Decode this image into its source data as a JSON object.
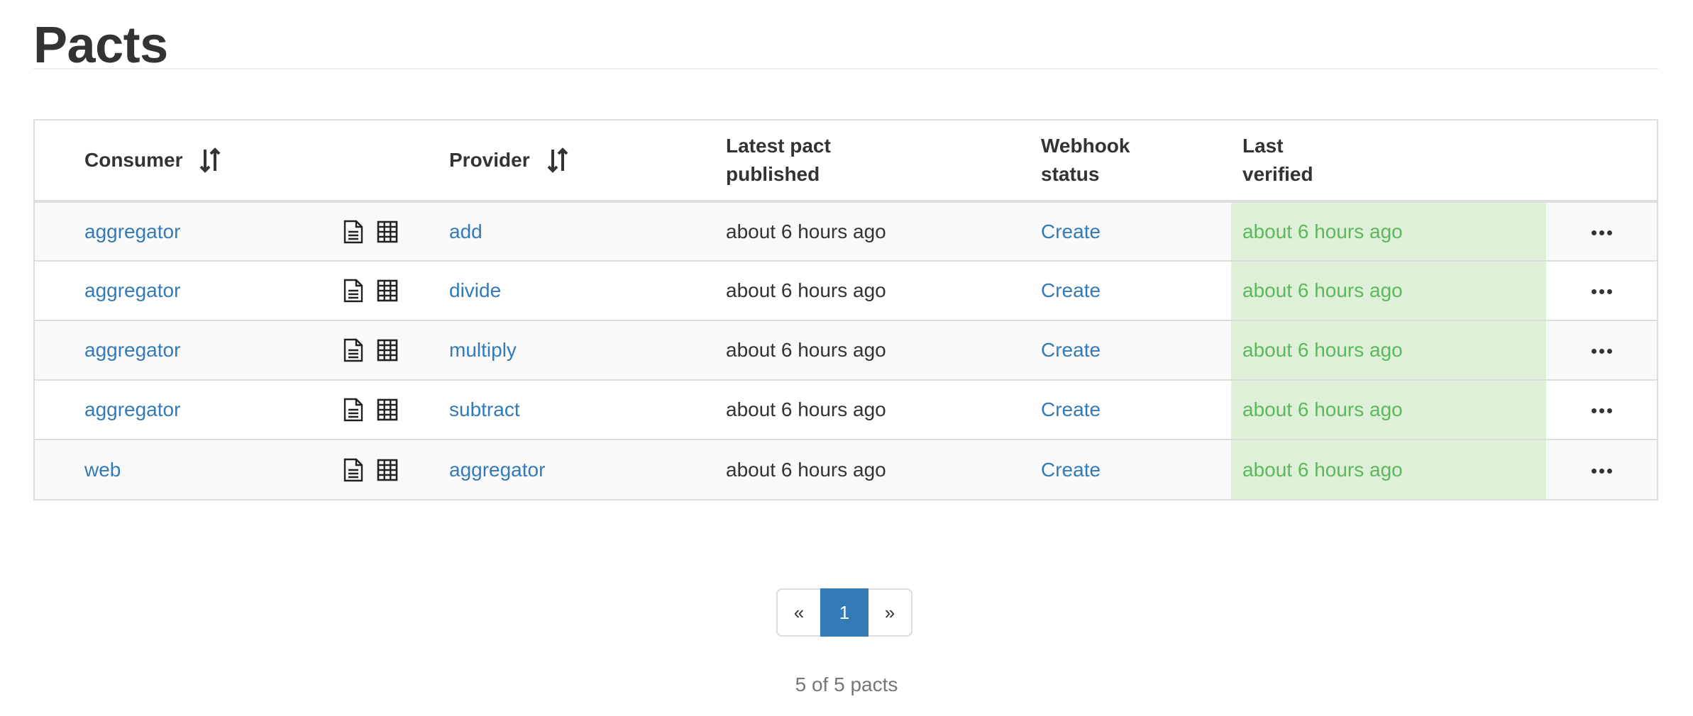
{
  "page": {
    "title": "Pacts"
  },
  "table": {
    "headers": {
      "consumer": "Consumer",
      "provider": "Provider",
      "latest_pact_line1": "Latest pact",
      "latest_pact_line2": "published",
      "webhook_line1": "Webhook",
      "webhook_line2": "status",
      "last_verified_line1": "Last",
      "last_verified_line2": "verified"
    },
    "rows": [
      {
        "consumer": "aggregator",
        "provider": "add",
        "published": "about 6 hours ago",
        "webhook": "Create",
        "verified": "about 6 hours ago"
      },
      {
        "consumer": "aggregator",
        "provider": "divide",
        "published": "about 6 hours ago",
        "webhook": "Create",
        "verified": "about 6 hours ago"
      },
      {
        "consumer": "aggregator",
        "provider": "multiply",
        "published": "about 6 hours ago",
        "webhook": "Create",
        "verified": "about 6 hours ago"
      },
      {
        "consumer": "aggregator",
        "provider": "subtract",
        "published": "about 6 hours ago",
        "webhook": "Create",
        "verified": "about 6 hours ago"
      },
      {
        "consumer": "web",
        "provider": "aggregator",
        "published": "about 6 hours ago",
        "webhook": "Create",
        "verified": "about 6 hours ago"
      }
    ]
  },
  "pagination": {
    "prev": "«",
    "current": "1",
    "next": "»"
  },
  "summary": "5 of 5 pacts",
  "colors": {
    "link": "#337ab7",
    "verified_bg": "#dff0d8",
    "verified_text": "#5cb85c",
    "active_page": "#337ab7"
  },
  "icons": {
    "sort": "sort-icon",
    "document": "document-icon",
    "matrix": "matrix-icon",
    "more": "ellipsis-icon"
  }
}
